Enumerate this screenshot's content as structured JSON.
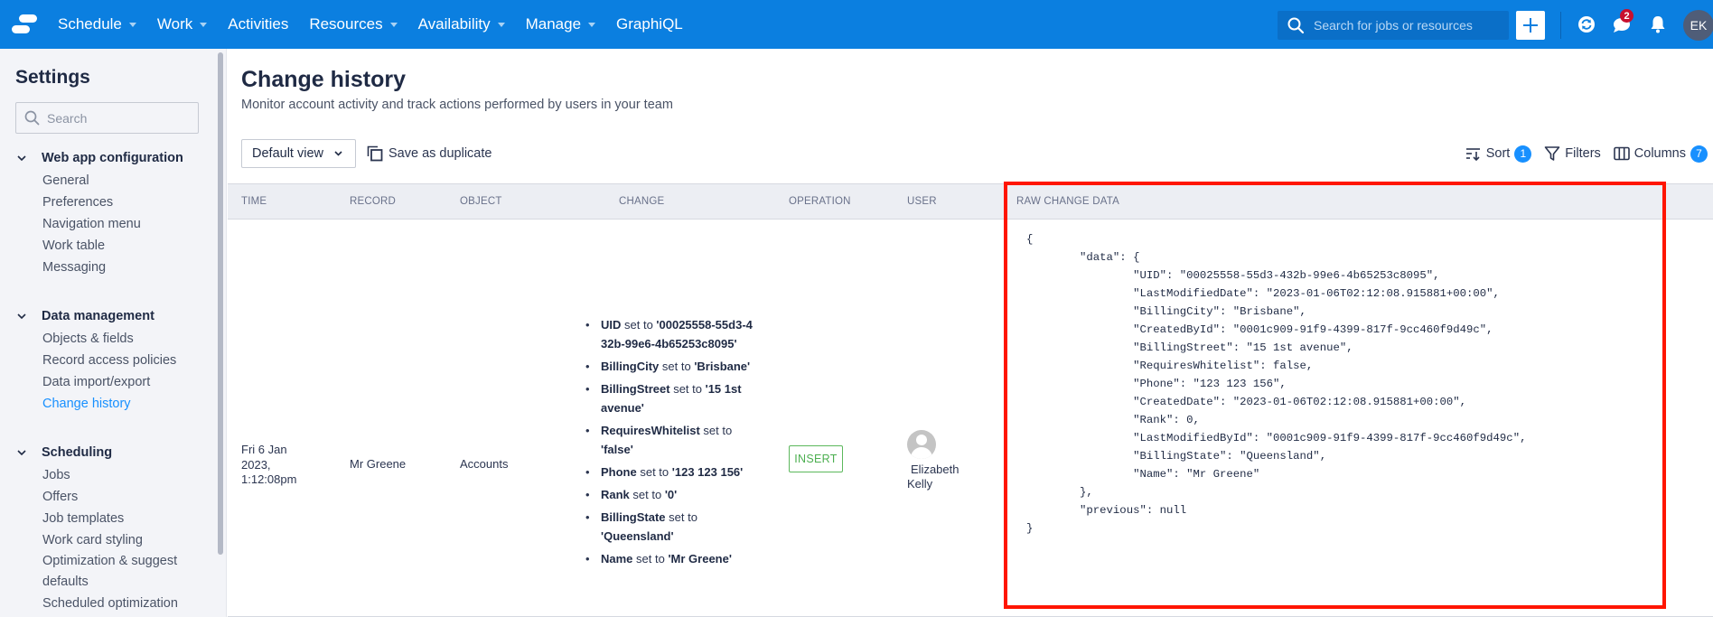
{
  "topnav": {
    "logo": "app-logo",
    "items": [
      {
        "label": "Schedule",
        "dropdown": true
      },
      {
        "label": "Work",
        "dropdown": true
      },
      {
        "label": "Activities",
        "dropdown": false
      },
      {
        "label": "Resources",
        "dropdown": true
      },
      {
        "label": "Availability",
        "dropdown": true
      },
      {
        "label": "Manage",
        "dropdown": true
      },
      {
        "label": "GraphiQL",
        "dropdown": false
      }
    ],
    "search_placeholder": "Search for jobs or resources",
    "add_icon": "plus-icon",
    "icons": [
      "sync-icon",
      "chat-icon",
      "bell-icon"
    ],
    "chat_badge": "2",
    "avatar_initials": "EK"
  },
  "sidebar": {
    "title": "Settings",
    "search_placeholder": "Search",
    "sections": [
      {
        "label": "Web app configuration",
        "items": [
          "General",
          "Preferences",
          "Navigation menu",
          "Work table",
          "Messaging"
        ]
      },
      {
        "label": "Data management",
        "items": [
          "Objects & fields",
          "Record access policies",
          "Data import/export",
          "Change history"
        ],
        "active": "Change history"
      },
      {
        "label": "Scheduling",
        "items": [
          "Jobs",
          "Offers",
          "Job templates",
          "Work card styling",
          "Optimization & suggest defaults",
          "Scheduled optimization"
        ]
      }
    ]
  },
  "main": {
    "title": "Change history",
    "subtitle": "Monitor account activity and track actions performed by users in your team",
    "view_select": "Default view",
    "save_duplicate": "Save as duplicate",
    "sort_label": "Sort",
    "sort_count": "1",
    "filters_label": "Filters",
    "columns_label": "Columns",
    "columns_count": "7"
  },
  "table": {
    "columns": [
      "TIME",
      "RECORD",
      "OBJECT",
      "CHANGE",
      "OPERATION",
      "USER",
      "RAW CHANGE DATA"
    ],
    "rows": [
      {
        "time_line1": "Fri 6 Jan",
        "time_line2": "2023,",
        "time_line3": "1:12:08pm",
        "record": "Mr Greene",
        "object": "Accounts",
        "changes": [
          {
            "field": "UID",
            "mid": " set to ",
            "value": "'00025558-55d3-432b-99e6-4b65253c8095'"
          },
          {
            "field": "BillingCity",
            "mid": " set to ",
            "value": "'Brisbane'"
          },
          {
            "field": "BillingStreet",
            "mid": " set to ",
            "value": "'15 1st avenue'"
          },
          {
            "field": "RequiresWhitelist",
            "mid": " set to ",
            "value": "'false'"
          },
          {
            "field": "Phone",
            "mid": " set to ",
            "value": "'123 123 156'"
          },
          {
            "field": "Rank",
            "mid": " set to ",
            "value": "'0'"
          },
          {
            "field": "BillingState",
            "mid": " set to ",
            "value": "'Queensland'"
          },
          {
            "field": "Name",
            "mid": " set to ",
            "value": "'Mr Greene'"
          }
        ],
        "operation": "INSERT",
        "user_first": "Elizabeth",
        "user_last": "Kelly",
        "raw": "{\n        \"data\": {\n                \"UID\": \"00025558-55d3-432b-99e6-4b65253c8095\",\n                \"LastModifiedDate\": \"2023-01-06T02:12:08.915881+00:00\",\n                \"BillingCity\": \"Brisbane\",\n                \"CreatedById\": \"0001c909-91f9-4399-817f-9cc460f9d49c\",\n                \"BillingStreet\": \"15 1st avenue\",\n                \"RequiresWhitelist\": false,\n                \"Phone\": \"123 123 156\",\n                \"CreatedDate\": \"2023-01-06T02:12:08.915881+00:00\",\n                \"Rank\": 0,\n                \"LastModifiedById\": \"0001c909-91f9-4399-817f-9cc460f9d49c\",\n                \"BillingState\": \"Queensland\",\n                \"Name\": \"Mr Greene\"\n        },\n        \"previous\": null\n}"
      }
    ]
  },
  "colors": {
    "nav_bg": "#0b7fe0",
    "accent": "#1890ff",
    "insert_green": "#4caf50",
    "highlight_red": "#ff1500",
    "badge_red": "#c8102e"
  }
}
